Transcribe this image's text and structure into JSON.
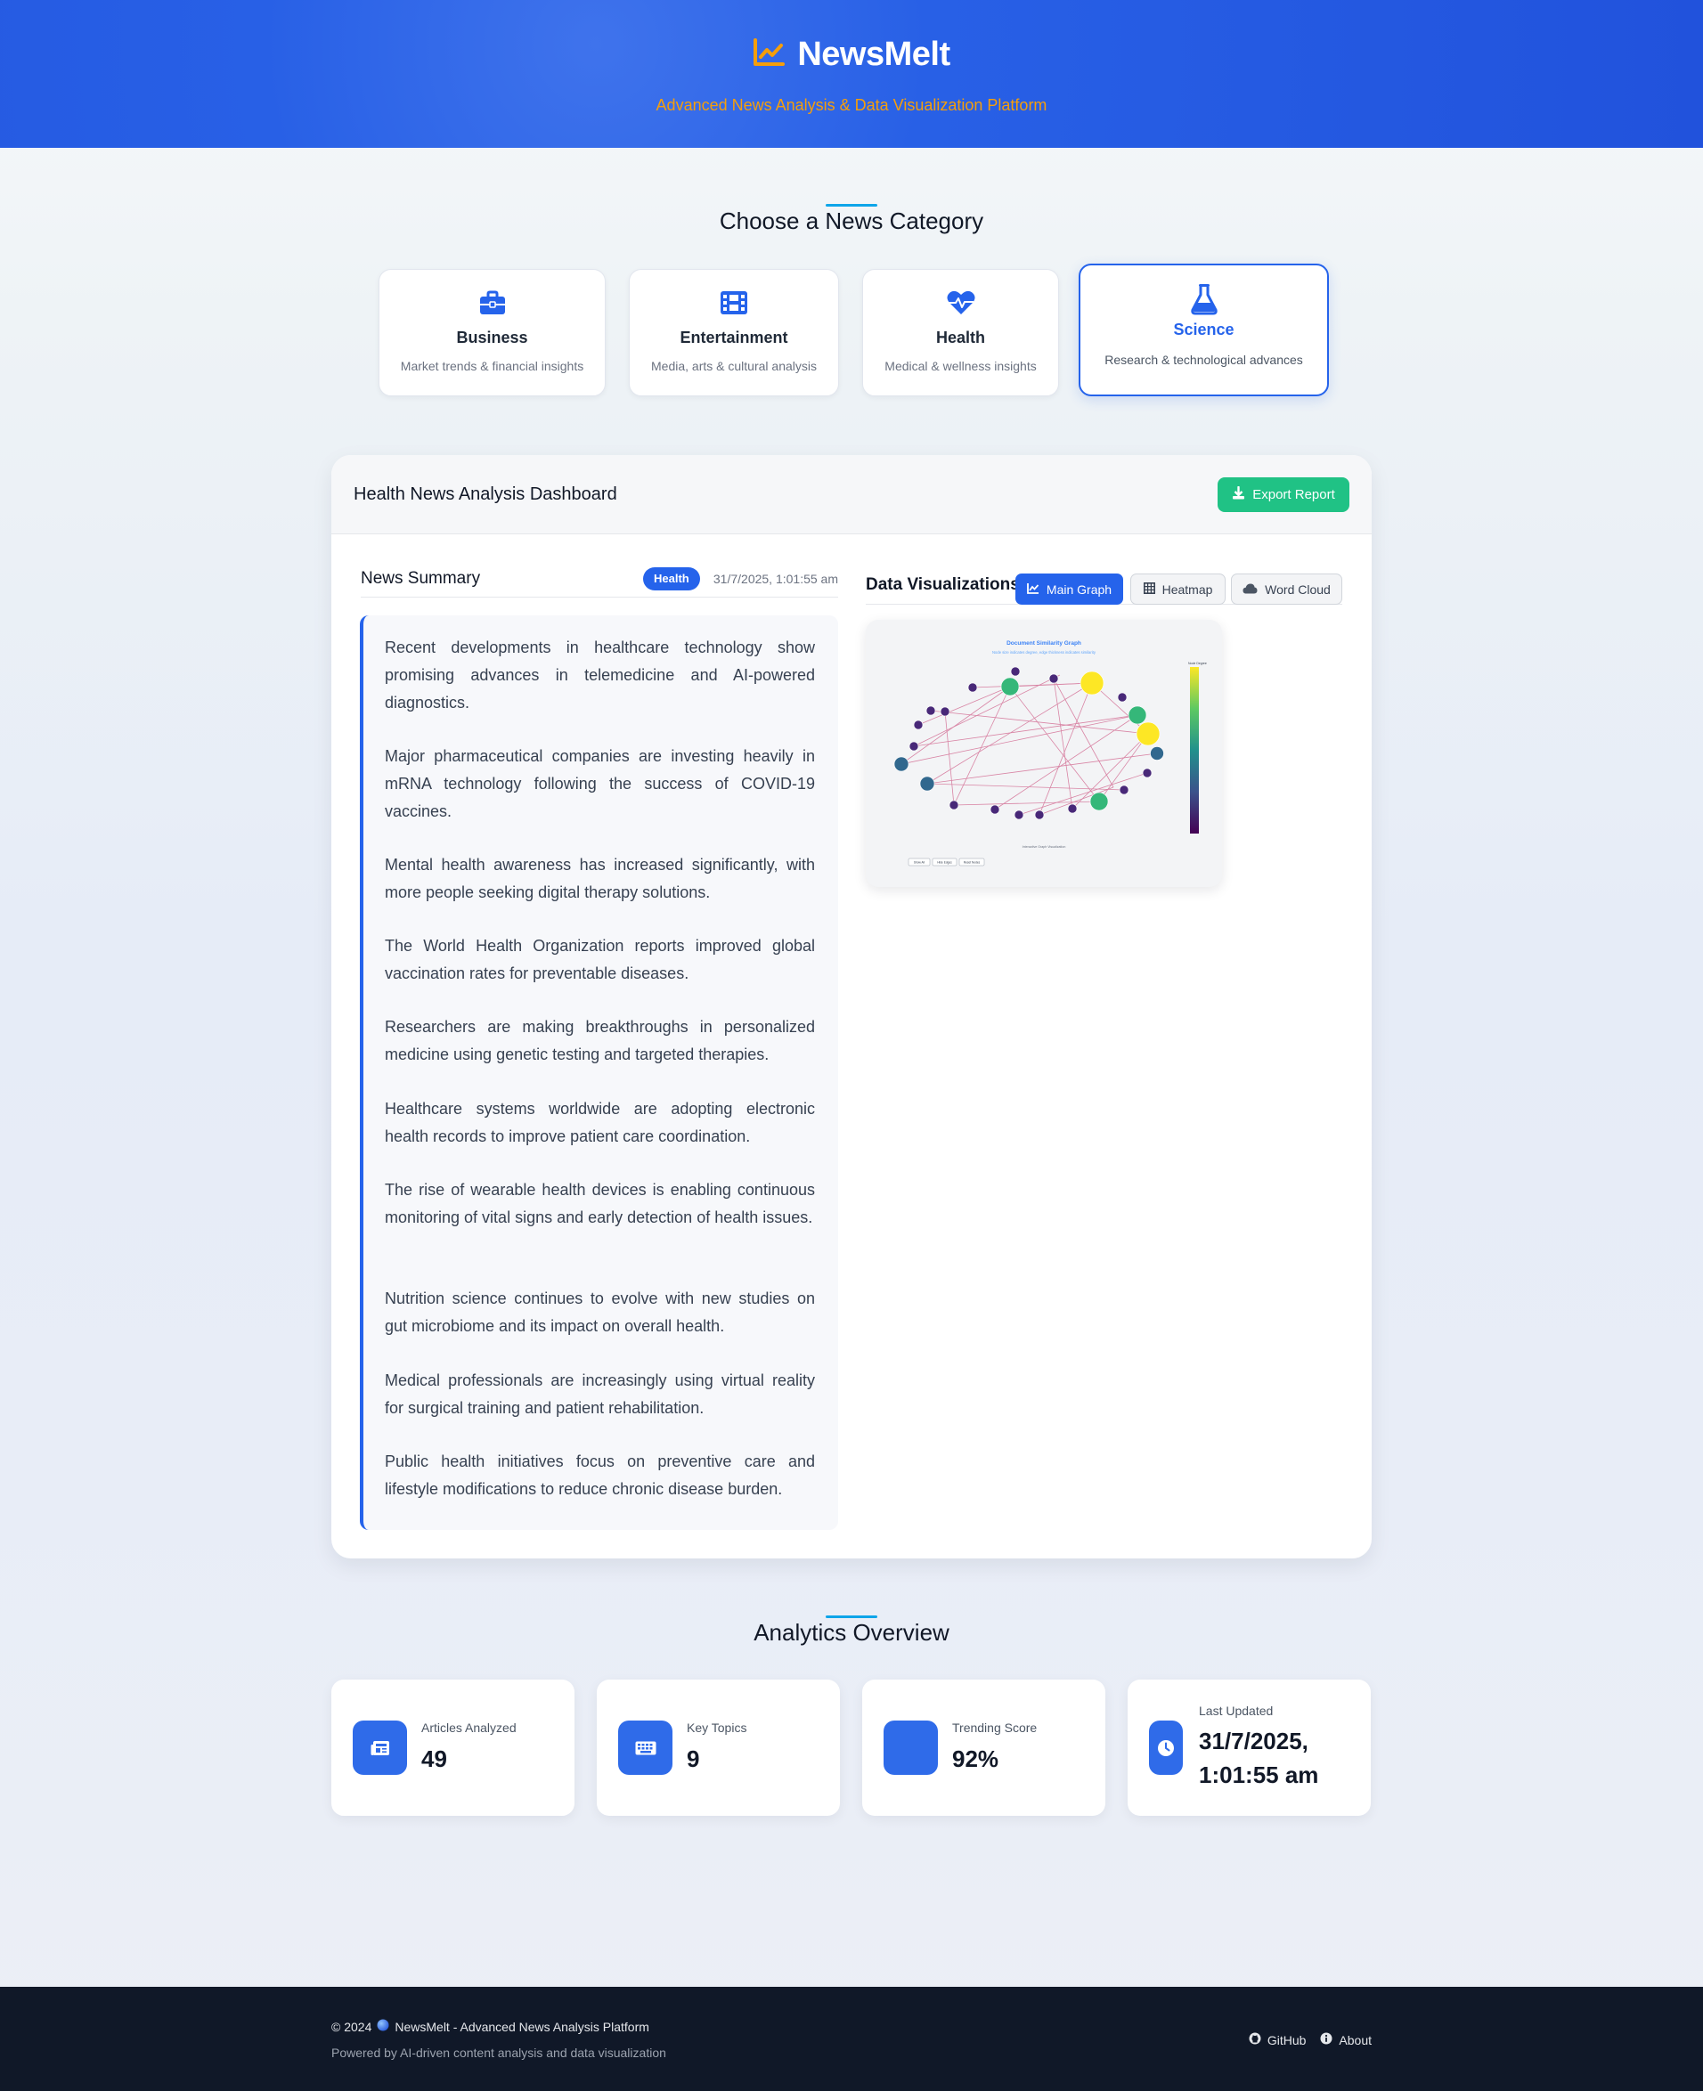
{
  "header": {
    "brand_name": "NewsMelt",
    "tagline": "Advanced News Analysis & Data Visualization Platform",
    "brand_icon": "chart-line-icon",
    "accent_color": "#f59e0b"
  },
  "categories_section": {
    "title": "Choose a News Category",
    "items": [
      {
        "name": "Business",
        "description": "Market trends & financial insights",
        "icon": "briefcase-icon"
      },
      {
        "name": "Entertainment",
        "description": "Media, arts & cultural analysis",
        "icon": "film-icon"
      },
      {
        "name": "Health",
        "description": "Medical & wellness insights",
        "icon": "heart-pulse-icon"
      },
      {
        "name": "Science",
        "description": "Research & technological advances",
        "icon": "flask-icon",
        "selected": true
      }
    ]
  },
  "dashboard": {
    "title": "Health News Analysis Dashboard",
    "export_label": "Export Report",
    "summary": {
      "title": "News Summary",
      "badge": "Health",
      "timestamp": "31/7/2025, 1:01:55 am",
      "paragraphs": [
        "Recent developments in healthcare technology show promising advances in telemedicine and AI-powered diagnostics.",
        "Major pharmaceutical companies are investing heavily in mRNA technology following the success of COVID-19 vaccines.",
        "Mental health awareness has increased significantly, with more people seeking digital therapy solutions.",
        "The World Health Organization reports improved global vaccination rates for preventable diseases.",
        "Researchers are making breakthroughs in personalized medicine using genetic testing and targeted therapies.",
        "Healthcare systems worldwide are adopting electronic health records to improve patient care coordination.",
        "The rise of wearable health devices is enabling continuous monitoring of vital signs and early detection of health issues.",
        "Nutrition science continues to evolve with new studies on gut microbiome and its impact on overall health.",
        "Medical professionals are increasingly using virtual reality for surgical training and patient rehabilitation.",
        "Public health initiatives focus on preventive care and lifestyle modifications to reduce chronic disease burden."
      ]
    },
    "visualizations": {
      "title": "Data Visualizations",
      "tabs": [
        {
          "label": "Main Graph",
          "icon": "chart-line-icon",
          "active": true
        },
        {
          "label": "Heatmap",
          "icon": "table-grid-icon",
          "active": false
        },
        {
          "label": "Word Cloud",
          "icon": "cloud-icon",
          "active": false
        }
      ],
      "graph": {
        "title": "Document Similarity Graph",
        "subtitle": "Node size indicates degree, edge thickness indicates similarity",
        "colorbar_title": "Node Degree",
        "footer_text": "Interactive Graph Visualization",
        "buttons": [
          "Show All",
          "Hide Edges",
          "Reset Nodes"
        ]
      }
    }
  },
  "analytics": {
    "title": "Analytics Overview",
    "cards": [
      {
        "label": "Articles Analyzed",
        "value": "49",
        "icon": "newspaper-icon"
      },
      {
        "label": "Key Topics",
        "value": "9",
        "icon": "keyboard-icon"
      },
      {
        "label": "Trending Score",
        "value": "92%",
        "icon": "trending-icon"
      },
      {
        "label": "Last Updated",
        "value": "31/7/2025, 1:01:55 am",
        "icon": "clock-icon"
      }
    ]
  },
  "footer": {
    "copyright": "© 2024",
    "platform": "NewsMelt - Advanced News Analysis Platform",
    "powered_by": "Powered by AI-driven content analysis and data visualization",
    "links": [
      {
        "label": "GitHub",
        "icon": "github-icon"
      },
      {
        "label": "About",
        "icon": "info-icon"
      }
    ]
  }
}
